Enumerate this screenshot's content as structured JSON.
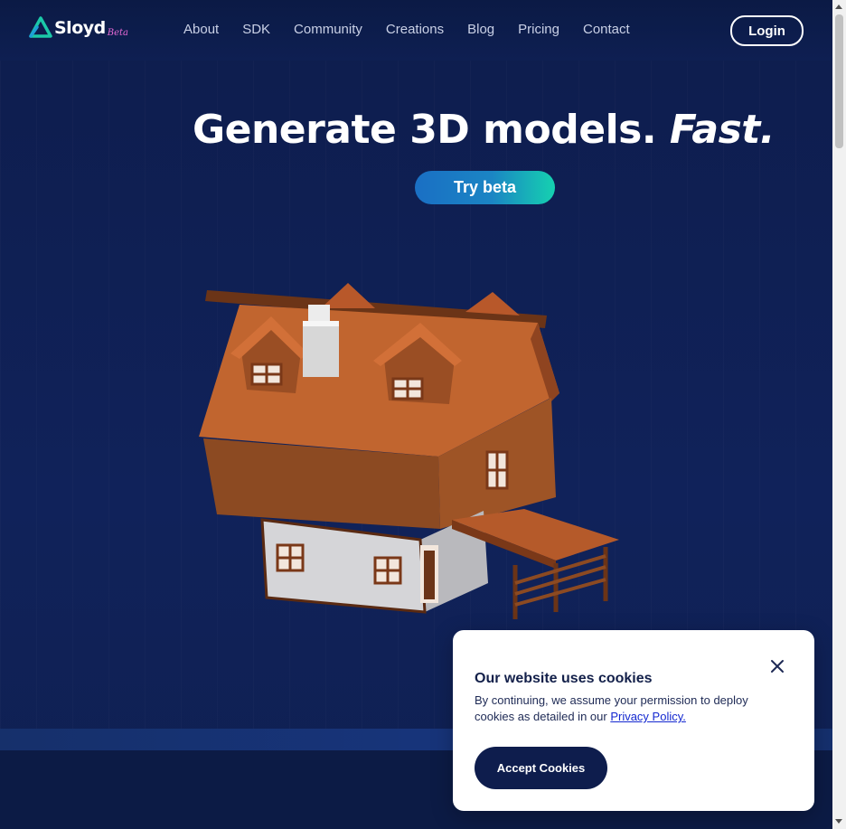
{
  "brand": {
    "name": "Sloyd",
    "badge": "Beta",
    "accent": "#1bc9a8"
  },
  "nav": {
    "items": [
      {
        "label": "About"
      },
      {
        "label": "SDK"
      },
      {
        "label": "Community"
      },
      {
        "label": "Creations"
      },
      {
        "label": "Blog"
      },
      {
        "label": "Pricing"
      },
      {
        "label": "Contact"
      }
    ],
    "login_label": "Login"
  },
  "hero": {
    "title_main": "Generate 3D models. ",
    "title_em": "Fast.",
    "cta_label": "Try beta"
  },
  "cookie": {
    "title": "Our website uses cookies",
    "text": "By continuing, we assume your permission to deploy cookies as detailed in our ",
    "link_label": "Privacy Policy.",
    "accept_label": "Accept Cookies"
  },
  "colors": {
    "background": "#0f1f4f",
    "cta_gradient_start": "#1a6fc4",
    "cta_gradient_end": "#15d1b0",
    "cookie_button": "#0e1d4d",
    "link": "#1428d0"
  }
}
